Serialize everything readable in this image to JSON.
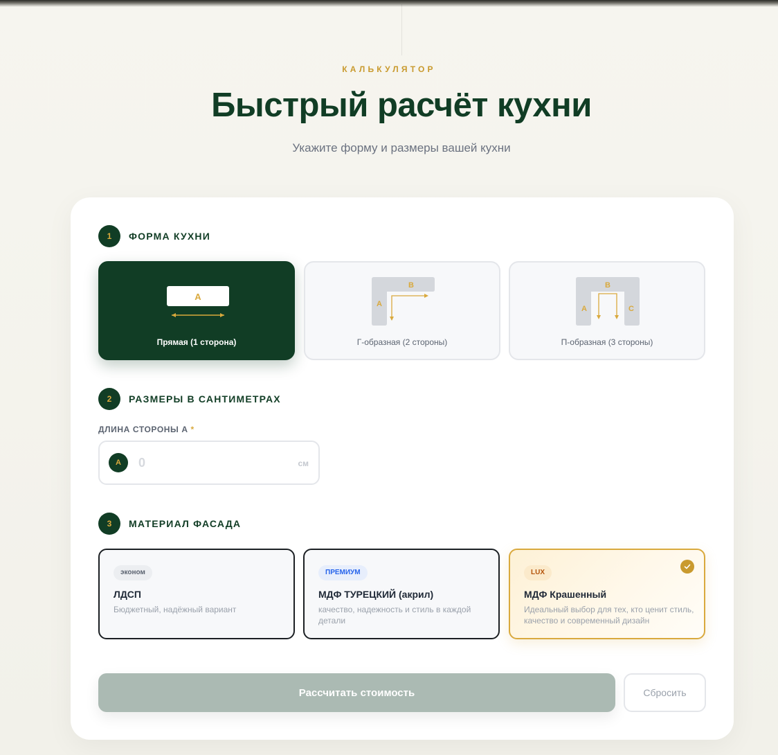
{
  "header": {
    "eyebrow": "КАЛЬКУЛЯТОР",
    "title": "Быстрый расчёт кухни",
    "subtitle": "Укажите форму и размеры вашей кухни"
  },
  "steps": {
    "shape": {
      "number": "1",
      "label": "ФОРМА КУХНИ"
    },
    "sizes": {
      "number": "2",
      "label": "РАЗМЕРЫ В САНТИМЕТРАХ"
    },
    "material": {
      "number": "3",
      "label": "МАТЕРИАЛ ФАСАДА"
    }
  },
  "shapes": [
    {
      "label": "Прямая (1 сторона)",
      "selected": true,
      "marks": [
        "A"
      ]
    },
    {
      "label": "Г-образная (2 стороны)",
      "selected": false,
      "marks": [
        "A",
        "B"
      ]
    },
    {
      "label": "П-образная (3 стороны)",
      "selected": false,
      "marks": [
        "A",
        "B",
        "C"
      ]
    }
  ],
  "sizes": {
    "field_label": "ДЛИНА СТОРОНЫ А",
    "required_mark": "*",
    "badge": "А",
    "value": "",
    "placeholder": "0",
    "unit": "см"
  },
  "materials": [
    {
      "tier": "эконом",
      "title": "ЛДСП",
      "description": "Бюджетный, надёжный вариант",
      "selected": false
    },
    {
      "tier": "ПРЕМИУМ",
      "title": "МДФ ТУРЕЦКИЙ (акрил)",
      "description": "качество, надежность и стиль в каждой детали",
      "selected": false
    },
    {
      "tier": "LUX",
      "title": "МДФ Крашенный",
      "description": "Идеальный выбор для тех, кто ценит стиль, качество и современный дизайн",
      "selected": true
    }
  ],
  "actions": {
    "calculate_label": "Рассчитать стоимость",
    "reset_label": "Сбросить"
  },
  "colors": {
    "brand_green": "#113d25",
    "accent_gold": "#d9a93d",
    "disabled_button": "#abbab3",
    "premium_blue": "#2563eb"
  }
}
